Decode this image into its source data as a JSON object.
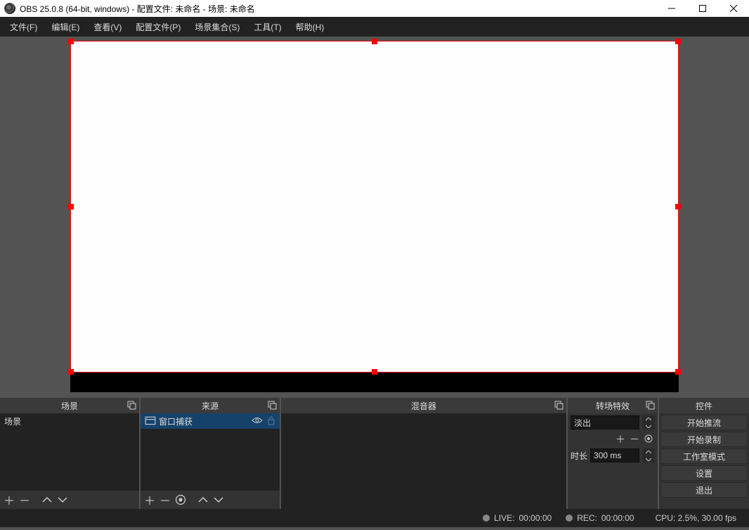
{
  "titlebar": {
    "title": "OBS 25.0.8 (64-bit, windows) - 配置文件: 未命名 - 场景: 未命名"
  },
  "menu": {
    "file": "文件(F)",
    "edit": "编辑(E)",
    "view": "查看(V)",
    "profile": "配置文件(P)",
    "scene_collection": "场景集合(S)",
    "tools": "工具(T)",
    "help": "帮助(H)"
  },
  "docks": {
    "scenes": {
      "title": "场景",
      "items": [
        "场景"
      ]
    },
    "sources": {
      "title": "来源",
      "items": [
        {
          "label": "窗口捕获"
        }
      ]
    },
    "mixer": {
      "title": "混音器"
    },
    "transitions": {
      "title": "转场特效",
      "selected": "淡出",
      "duration_label": "时长",
      "duration_value": "300 ms"
    },
    "controls": {
      "title": "控件",
      "buttons": {
        "stream": "开始推流",
        "record": "开始录制",
        "studio": "工作室模式",
        "settings": "设置",
        "exit": "退出"
      }
    }
  },
  "status": {
    "live_label": "LIVE:",
    "live_time": "00:00:00",
    "rec_label": "REC:",
    "rec_time": "00:00:00",
    "cpu": "CPU: 2.5%, 30.00 fps"
  }
}
